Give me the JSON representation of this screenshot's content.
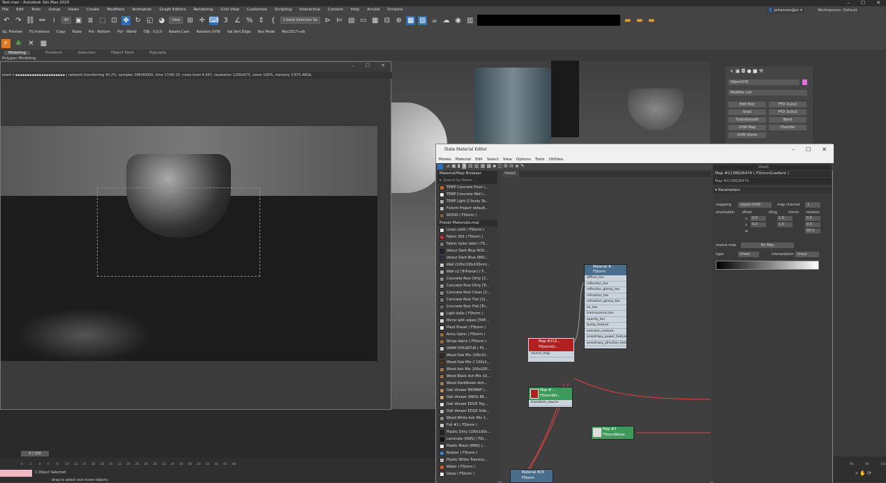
{
  "app": {
    "title": "Test.max - Autodesk 3ds Max 2020"
  },
  "menu": [
    "File",
    "Edit",
    "Tools",
    "Group",
    "Views",
    "Create",
    "Modifiers",
    "Animation",
    "Graph Editors",
    "Rendering",
    "Civil View",
    "Customize",
    "Scripting",
    "Interactive",
    "Content",
    "Help",
    "Arnold",
    "Ornatrix"
  ],
  "toolbar": {
    "filter_value": "All",
    "view_value": "View",
    "selection_set_placeholder": "Create Selection Se",
    "user": "johannes@cr",
    "workspaces": "Workspaces: Default"
  },
  "toolbar2": [
    "Sq. Preview",
    "FS Instance",
    "Copy",
    "Paste",
    "Pvt - Bottom",
    "Pvt - World",
    "OBJ - 0,0,0",
    "Rotate Cam",
    "Random UVW",
    "Sel.Vert.Edge",
    "Box Mode",
    "Mac2017+ob"
  ],
  "ribbon": {
    "tabs": [
      "Modeling",
      "Freeform",
      "Selection",
      "Object Paint",
      "Populate"
    ],
    "sub": "Polygon Modeling"
  },
  "render_window": {
    "dropdown": "erent",
    "status": "network transferring 40.2%, samples 286/40000, time 17/40:15, noise level 4.067, resolution 1200x675, zoom 100%, memory 3.875.46Gb"
  },
  "command_panel": {
    "object_name": "Object230",
    "modifier_list": "Modifier List",
    "buttons": [
      "Edit Poly",
      "FFD 2x2x2",
      "Shell",
      "FFD 3x3x3",
      "TurboSmooth",
      "Bend",
      "UVW Map",
      "Chamfer",
      "UVW Xform"
    ]
  },
  "slate": {
    "title": "Slate Material Editor",
    "menu": [
      "Modes",
      "Material",
      "Edit",
      "Select",
      "View",
      "Options",
      "Tools",
      "Utilities"
    ],
    "browser_header": "Material/Map Browser",
    "search_placeholder": "Search by Name ...",
    "items_top": [
      "TEMP Concrete Floor  (...",
      "TEMP Concrete Wall  (...",
      "TEMP Light [Cloudy Sk...",
      "Fstorm Project default...",
      "WOOD  ( FStorm )"
    ],
    "preset_header": "Preset Materials.mat",
    "preset_items": [
      "Linen cloth  ( FStorm )",
      "Fabric 001  ( FStorm )",
      "Fabric nylon label  ( FS...",
      "Velour Dark Blue ROU...",
      "Velour Dark Blue SMO...",
      "Wall  (100x100x100cm)...",
      "Wall v2 (TriPlanar)  ( F...",
      "Concrete floor Dirty [3...",
      "Concrete floor Dirty [Tr...",
      "Concrete floor Clean [3...",
      "Concrete floor Flat [3]...",
      "Concrete floor Flat [Tri...",
      "Light balls  ( FStorm )",
      "Mirror with wipes [TriPl...",
      "Plant Preset  ( FStorm )",
      "Army fabric  ( FStorm )",
      "Stripe fabric  ( FStorm )",
      "VARM STRUKTUR  ( FS...",
      "Wood Oak Mix 100x10...",
      "Wood Oak Mix 2 100x1...",
      "Wood Ash Mix 100x100...",
      "Wood Black Ash Mix 10...",
      "Wood DarkBrown Ash...",
      "Oak Veneer MDIMAP (...",
      "Oak Veneer (RWS) 8K...",
      "Oak Veneer EDGE Top...",
      "Oak Veneer EDGE Side...",
      "Wood White Ash Mix 1...",
      "Foil #1  ( FStorm )",
      "Plastic Dirty (100x100x...",
      "Laminate (RWS)  ( FSt...",
      "Plastic Black (RWS)  (...",
      "Rubber  ( FStorm )",
      "Plastic White Transluc...",
      "Water  ( FStorm )",
      "Glass  ( FStorm )"
    ],
    "view_tab": "View1",
    "view_dropdown": "View1",
    "param_title": "Map #2138626474  ( FStormGradient )",
    "param_name": "Map #2138626474",
    "param_section": "Parameters",
    "mapping_label": "mapping",
    "mapping_value": "object UVW",
    "map_channel_label": "map channel",
    "map_channel_value": "1",
    "cols": [
      "orientation",
      "offset",
      "tiling",
      "mirror",
      "rotation"
    ],
    "rows": [
      {
        "axis": "u",
        "offset": "0.0",
        "tiling": "1.0",
        "rotation": "0.0"
      },
      {
        "axis": "v",
        "offset": "0.0",
        "tiling": "1.0",
        "rotation": "0.0"
      },
      {
        "axis": "w",
        "offset": "",
        "tiling": "",
        "rotation": "90.0"
      }
    ],
    "source_map_label": "source map",
    "source_map_value": "No Map",
    "type_label": "type",
    "type_value": "linear",
    "interp_label": "interpolation",
    "interp_value": "linear",
    "node_material": {
      "title": "Material #...",
      "subtitle": "FStorm",
      "slots": [
        "diffuse_tex",
        "reflection_tex",
        "reflection_glossy_tex",
        "refraction_tex",
        "refraction_glossy_tex",
        "ior_tex",
        "translucence_tex",
        "opacity_tex",
        "bump_texture",
        "emission_texture",
        "anisotropy_power_texture",
        "anisotropy_direction_text..."
      ]
    },
    "node_map1": {
      "title": "Map #213...",
      "subtitle": "FStormGr...",
      "slot": "source_map"
    },
    "node_map2": {
      "title": "Map #...",
      "subtitle": "FStormBit...",
      "slot": "transform_source"
    },
    "node_map3": {
      "title": "Map #3",
      "subtitle": "FStormNoise"
    },
    "node_mat25": {
      "title": "Material #25",
      "subtitle": "FStorm"
    }
  },
  "status": {
    "frame": "0 / 100",
    "selected": "1 Object Selected",
    "prompt": "drag to select and move objects",
    "ticks": [
      "0",
      "2",
      "4",
      "6",
      "8",
      "10",
      "12",
      "14",
      "16",
      "18",
      "20",
      "22",
      "24",
      "26",
      "28",
      "30",
      "32",
      "34",
      "36",
      "38",
      "40",
      "42",
      "44",
      "46",
      "48"
    ],
    "right_ticks": [
      "96",
      "98",
      "100"
    ]
  },
  "colors": {
    "accent": "#2f6fb6",
    "node_header": "#4a6d8c",
    "node_red": "#b02020",
    "node_green": "#3d9a5a",
    "wire": "#e04040"
  }
}
